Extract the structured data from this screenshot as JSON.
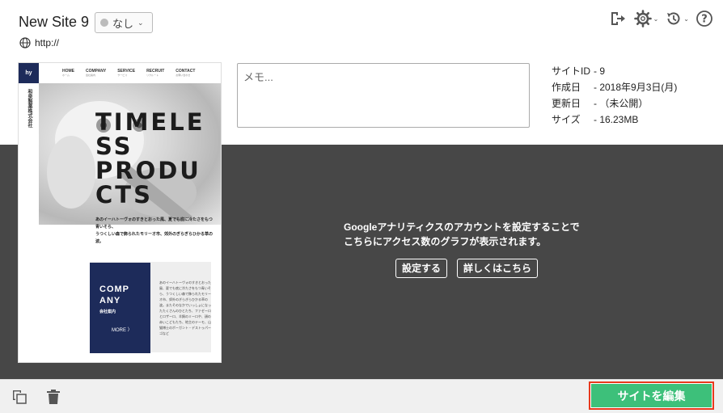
{
  "site": {
    "title": "New Site 9",
    "url": "http://"
  },
  "status": {
    "label": "なし"
  },
  "toolbar": {
    "icons": [
      "exit-icon",
      "gear-icon",
      "history-icon",
      "help-icon"
    ]
  },
  "memo": {
    "placeholder": "メモ..."
  },
  "meta": [
    {
      "key": "サイトID",
      "value": "- 9"
    },
    {
      "key": "作成日",
      "value": "- 2018年9月3日(月)"
    },
    {
      "key": "更新日",
      "value": "- （未公開）"
    },
    {
      "key": "サイズ",
      "value": "- 16.23MB"
    }
  ],
  "preview": {
    "logo": "hy",
    "company_vertical": "和泉製薬株式会社",
    "nav": [
      {
        "label": "HOME",
        "sub": "ホーム"
      },
      {
        "label": "COMPANY",
        "sub": "会社案内"
      },
      {
        "label": "SERVICE",
        "sub": "サービス"
      },
      {
        "label": "RECRUIT",
        "sub": "リクルート"
      },
      {
        "label": "CONTACT",
        "sub": "お問い合わせ"
      }
    ],
    "hero_lines": [
      "TIMELE",
      "SS",
      "PRODU",
      "CTS"
    ],
    "copy_lines": [
      "あのイーハトーヴォのすきとおった風、夏でも底に冷たさをもつ",
      "青いそら、",
      "うつくしい森で飾られたモリーオ市、郊外のぎらぎらひかる草の",
      "波。"
    ],
    "company_title_1": "COMP",
    "company_title_2": "ANY",
    "company_sub": "会社案内",
    "more": "MORE 〉",
    "company_text": "あのイーハトーヴォのすきとおった風、夏でも底に冷たさをもつ青いそら、うつくしい森で飾られたモリーオ市、郊外のぎらぎらひかる草の波。またそのなかでいっしょになったたくさんのひとたち、ファゼーロとロザーロ、羊飼のミーロや、顔の赤いこどもたち、地主のテーモ、山猫博士のボーガント・デストゥパーゴなど"
  },
  "analytics": {
    "message_line1": "Googleアナリティクスのアカウントを設定することで",
    "message_line2": "こちらにアクセス数のグラフが表示されます。",
    "setup_button": "設定する",
    "details_button": "詳しくはこちら"
  },
  "footer": {
    "edit_button": "サイトを編集"
  },
  "colors": {
    "accent_green": "#3dc07a",
    "highlight_red": "#e8391d",
    "dark_panel": "#474747",
    "navy": "#1d2b5a"
  }
}
